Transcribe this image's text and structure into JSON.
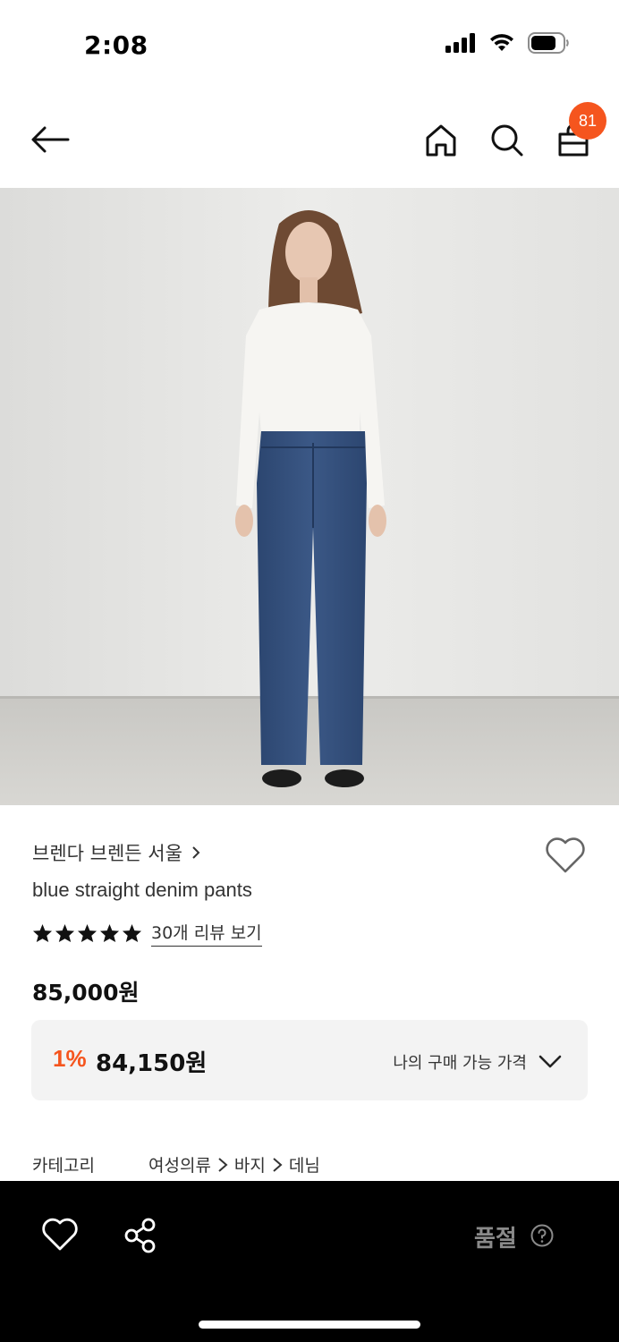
{
  "status_bar": {
    "time": "2:08"
  },
  "nav": {
    "cart_count": "81",
    "icons": [
      "back-arrow-icon",
      "home-icon",
      "search-icon",
      "shopping-bag-icon"
    ]
  },
  "product": {
    "brand": "브렌다 브렌든 서울",
    "name": "blue straight denim pants",
    "rating_stars": 5,
    "review_link": "30개 리뷰 보기",
    "price": "85,000원",
    "discount": {
      "rate": "1%",
      "price": "84,150원",
      "label": "나의 구매 가능 가격"
    },
    "category": {
      "label": "카테고리",
      "path": [
        "여성의류",
        "바지",
        "데님"
      ]
    }
  },
  "bottom_bar": {
    "status_label": "품절"
  },
  "colors": {
    "accent": "#f5551e",
    "bottom_bar": "#000000",
    "soldout_text": "#8a8a8a"
  }
}
